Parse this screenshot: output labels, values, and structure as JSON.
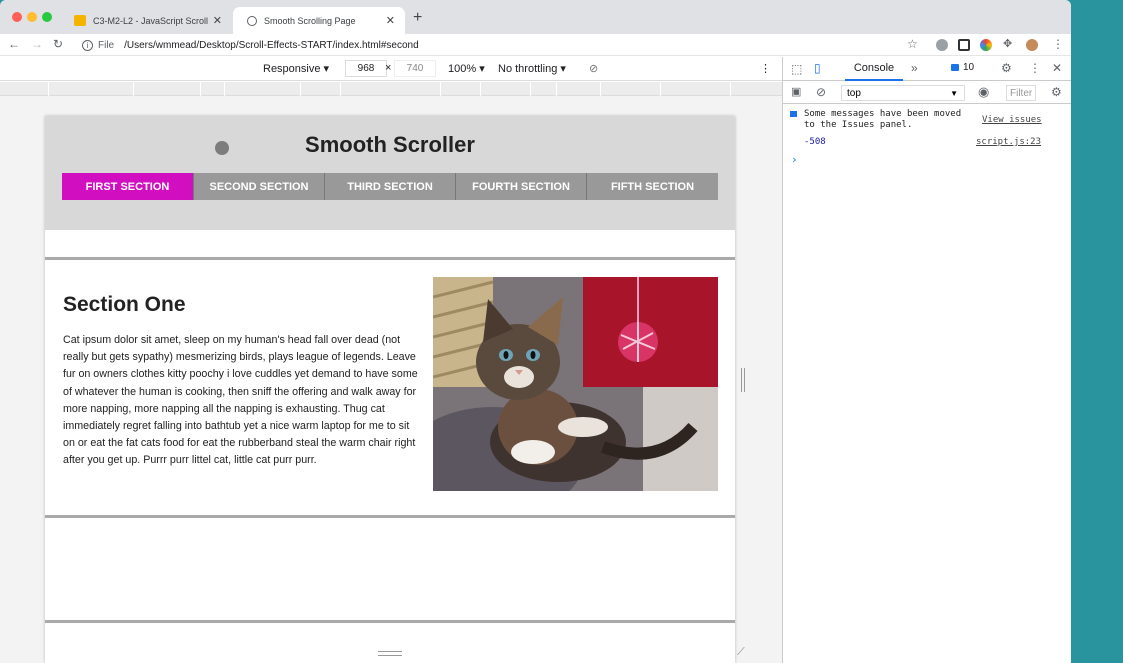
{
  "browser": {
    "tabs": [
      {
        "title": "C3-M2-L2 - JavaScript Scroll",
        "active": false
      },
      {
        "title": "Smooth Scrolling Page",
        "active": true
      }
    ],
    "file_label": "File",
    "url": "/Users/wmmead/Desktop/Scroll-Effects-START/index.html#second"
  },
  "device_toolbar": {
    "mode": "Responsive",
    "width": "968",
    "times": "×",
    "height": "740",
    "zoom": "100%",
    "throttling": "No throttling"
  },
  "page": {
    "site_title": "Smooth Scroller",
    "nav": [
      {
        "label": "FIRST SECTION",
        "active": true
      },
      {
        "label": "SECOND SECTION",
        "active": false
      },
      {
        "label": "THIRD SECTION",
        "active": false
      },
      {
        "label": "FOURTH SECTION",
        "active": false
      },
      {
        "label": "FIFTH SECTION",
        "active": false
      }
    ],
    "section_title": "Section One",
    "section_text": "Cat ipsum dolor sit amet, sleep on my human's head fall over dead (not really but gets sypathy) mesmerizing birds, plays league of legends. Leave fur on owners clothes kitty poochy i love cuddles yet demand to have some of whatever the human is cooking, then sniff the offering and walk away for more napping, more napping all the napping is exhausting. Thug cat immediately regret falling into bathtub yet a nice warm laptop for me to sit on or eat the fat cats food for eat the rubberband steal the warm chair right after you get up. Purrr purr littel cat, little cat purr purr."
  },
  "devtools": {
    "console_tab": "Console",
    "more_tabs": "»",
    "issues_count": "10",
    "context": "top",
    "filter_placeholder": "Filter",
    "messages": [
      {
        "text_line1": "Some messages have been moved",
        "text_line2": "to the Issues panel.",
        "link": "View issues"
      },
      {
        "value": "-508",
        "source": "script.js:23"
      }
    ],
    "prompt": "›"
  },
  "colors": {
    "accent": "#d10fc0",
    "nav_bg": "#999999",
    "header_bg": "#d8d8d8",
    "desktop": "#2a949e"
  }
}
